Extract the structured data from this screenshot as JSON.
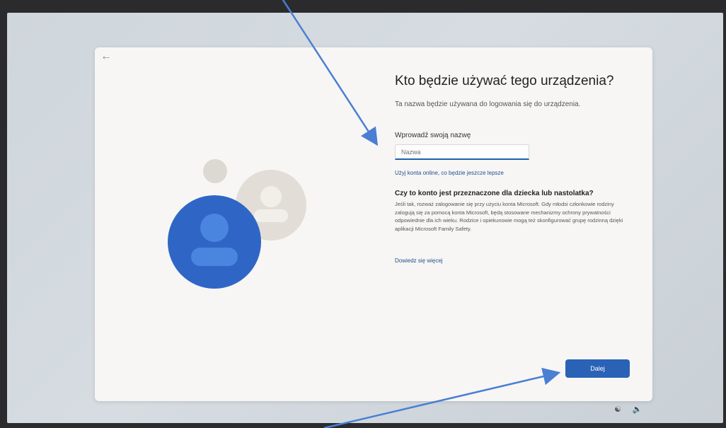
{
  "setup": {
    "back_icon": "arrow-left-icon",
    "title": "Kto będzie używać tego urządzenia?",
    "subtitle": "Ta nazwa będzie używana do logowania się do urządzenia.",
    "name_label": "Wprowadź swoją nazwę",
    "name_placeholder": "Nazwa",
    "name_value": "",
    "online_account_link": "Użyj konta online, co będzie jeszcze lepsze",
    "child_heading": "Czy to konto jest przeznaczone dla dziecka lub nastolatka?",
    "child_body": "Jeśli tak, rozważ zalogowanie się przy użyciu konta Microsoft. Gdy młodsi członkowie rodziny zalogują się za pomocą konta Microsoft, będą stosowane mechanizmy ochrony prywatności odpowiednie dla ich wieku. Rodzice i opiekunowie mogą też skonfigurować grupę rodzinną dzięki aplikacji Microsoft Family Safety.",
    "learn_more_link": "Dowiedz się więcej",
    "next_button": "Dalej"
  },
  "taskbar": {
    "icons": [
      "accessibility-icon",
      "volume-icon"
    ]
  },
  "colors": {
    "accent": "#2a62b6",
    "link": "#1f4f8f",
    "window_bg": "#f7f6f4",
    "annotation_arrow": "#4a7fd4"
  }
}
